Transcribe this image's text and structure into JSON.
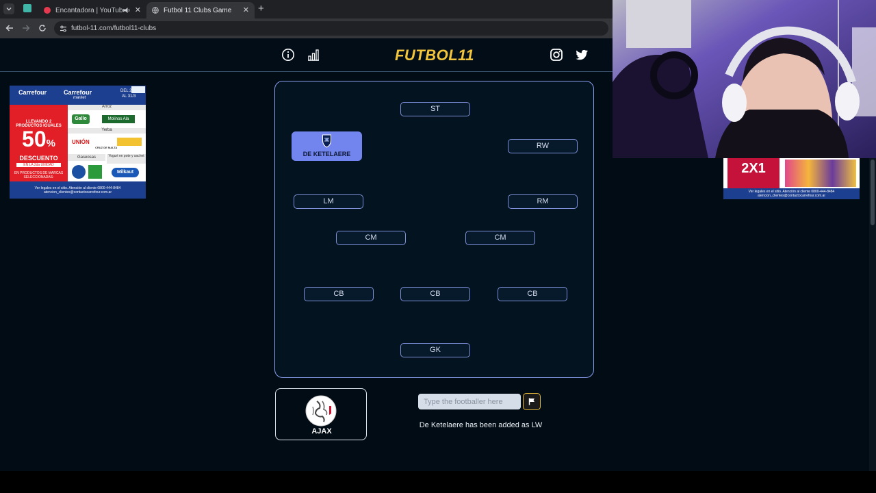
{
  "browser": {
    "tabs": [
      {
        "title": "Encantadora | YouTube Mu",
        "icon": "youtube-music-icon",
        "active": false,
        "has_audio": true
      },
      {
        "title": "Futbol 11 Clubs Game",
        "icon": "globe-icon",
        "active": true
      }
    ],
    "url": "futbol-11.com/futbol11-clubs"
  },
  "header": {
    "logo": "FUTBOL11",
    "left_icons": [
      "info-icon",
      "stats-icon"
    ],
    "right_icons": [
      "instagram-icon",
      "twitter-icon"
    ]
  },
  "ads": {
    "left": {
      "brand_a": "Carrefour",
      "brand_b": "Carrefour",
      "brand_b_sub": "market",
      "dates_a": "DEL 2",
      "dates_b": "AL 31/3",
      "promo_top": "LLEVANDO 2 PRODUCTOS IGUALES",
      "promo_big": "50",
      "promo_pct": "%",
      "promo_desc": "DESCUENTO",
      "promo_unit": "EN LA 2da UNIDAD",
      "promo_foot": "EN PRODUCTOS DE MARCAS SELECCIONADAS:",
      "cat_1": "Arroz",
      "cat_2": "Yerba",
      "cat_3": "Gaseosas",
      "cat_4": "Yogurt en pote y sachet",
      "brand_1": "Gallo",
      "brand_2": "Molinos Ala",
      "brand_3": "UNIÓN",
      "brand_4": "CRUZ DE MALTA",
      "brand_5": "Milkaut",
      "legal_1": "Ver legales en el sitio. Atención al cliente 0800-444-8484",
      "legal_2": "atencion_clientes@contactocarrefour.com.ar"
    },
    "right": {
      "promo": "2X1",
      "legal_1": "Ver legales en el sitio. Atención al cliente 0800-444-8484",
      "legal_2": "atencion_clientes@contactocarrefour.com.ar"
    }
  },
  "pitch": {
    "slots": {
      "st": "ST",
      "rw": "RW",
      "lm": "LM",
      "rm": "RM",
      "cm_left": "CM",
      "cm_right": "CM",
      "cb_left": "CB",
      "cb_center": "CB",
      "cb_right": "CB",
      "gk": "GK"
    },
    "filled_player": "DE KETELAERE",
    "filled_position": "LW"
  },
  "club": {
    "name": "AJAX",
    "crest": "ajax-crest-icon"
  },
  "search": {
    "placeholder": "Type the footballer here",
    "value": ""
  },
  "flag_button": {
    "icon": "flag-icon"
  },
  "message": "De Ketelaere has been added as LW",
  "colors": {
    "background": "#020c14",
    "accent": "#7285ef",
    "logo": "#f2c53d",
    "slot_border": "#7e90d8",
    "flag_border": "#e7b93b"
  }
}
